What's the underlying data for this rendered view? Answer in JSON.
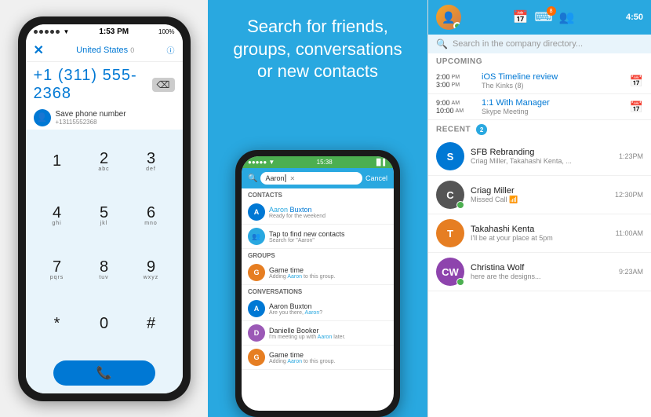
{
  "phone1": {
    "status_dots": 5,
    "wifi": "wifi",
    "time": "1:53 PM",
    "battery": "100%",
    "country": "United States",
    "country_info": "0",
    "number": "+1 (311) 555-2368",
    "save_label": "Save phone number",
    "save_sub": "+13115552368",
    "keys": [
      {
        "num": "1",
        "alpha": ""
      },
      {
        "num": "2",
        "alpha": "abc"
      },
      {
        "num": "3",
        "alpha": "def"
      },
      {
        "num": "4",
        "alpha": "ghi"
      },
      {
        "num": "5",
        "alpha": "jkl"
      },
      {
        "num": "6",
        "alpha": "mno"
      },
      {
        "num": "7",
        "alpha": "pqrs"
      },
      {
        "num": "8",
        "alpha": "tuv"
      },
      {
        "num": "9",
        "alpha": "wxyz"
      },
      {
        "num": "*",
        "alpha": ""
      },
      {
        "num": "0",
        "alpha": ""
      },
      {
        "num": "#",
        "alpha": ""
      }
    ]
  },
  "middle": {
    "headline": "Search for friends,\ngroups, conversations\nor new contacts"
  },
  "search_phone": {
    "status_bar_left": "●●●●● ▼",
    "status_bar_time": "15:38",
    "status_bar_right": "▐▌▌",
    "search_text": "Aaron",
    "cancel": "Cancel",
    "sections": [
      {
        "label": "Contacts",
        "items": [
          {
            "name": "Aaron Buxton",
            "highlight": "Aaron",
            "sub": "Ready for the weekend",
            "color": "#0078d4"
          },
          {
            "name": "Tap to find new contacts",
            "sub": "Search for \"Aaron\"",
            "color": "#29a8e0",
            "is_search": true
          }
        ]
      },
      {
        "label": "Groups",
        "items": [
          {
            "name": "Game time",
            "sub": "Adding Aaron to this group.",
            "color": "#e67e22"
          }
        ]
      },
      {
        "label": "Conversations",
        "items": [
          {
            "name": "Aaron Buxton",
            "sub": "Are you there, Aaron?",
            "color": "#0078d4"
          },
          {
            "name": "Danielle Booker",
            "sub": "I'm meeting up with Aaron later.",
            "color": "#9b59b6"
          },
          {
            "name": "Game time",
            "sub": "Adding Aaron to this group.",
            "color": "#e67e22"
          }
        ]
      }
    ]
  },
  "right_panel": {
    "time": "4:50",
    "badge_count": "8",
    "search_placeholder": "Search in the company directory...",
    "upcoming_label": "UPCOMING",
    "recent_label": "RECENT",
    "recent_badge": "2",
    "upcoming_items": [
      {
        "start_time": "2:00",
        "start_ampm": "PM",
        "end_time": "3:00",
        "end_ampm": "PM",
        "title": "iOS Timeline review",
        "sub": "The Kinks (8)"
      },
      {
        "start_time": "9:00",
        "start_ampm": "AM",
        "end_time": "10:00",
        "end_ampm": "AM",
        "title": "1:1 With Manager",
        "sub": "Skype Meeting"
      }
    ],
    "recent_items": [
      {
        "name": "SFB Rebranding",
        "sub": "Criag Miller, Takahashi Kenta, ...",
        "time": "1:23PM",
        "initials": "S",
        "color": "#0078d4"
      },
      {
        "name": "Criag Miller",
        "sub": "Missed Call 📶",
        "time": "12:30PM",
        "initials": "C",
        "color": "#555",
        "has_check": true
      },
      {
        "name": "Takahashi Kenta",
        "sub": "I'll be at your place at 5pm",
        "time": "11:00AM",
        "initials": "T",
        "color": "#e67e22"
      },
      {
        "name": "Christina Wolf",
        "sub": "here are the designs...",
        "time": "9:23AM",
        "initials": "CW",
        "color": "#8e44ad",
        "has_check": true
      }
    ]
  }
}
